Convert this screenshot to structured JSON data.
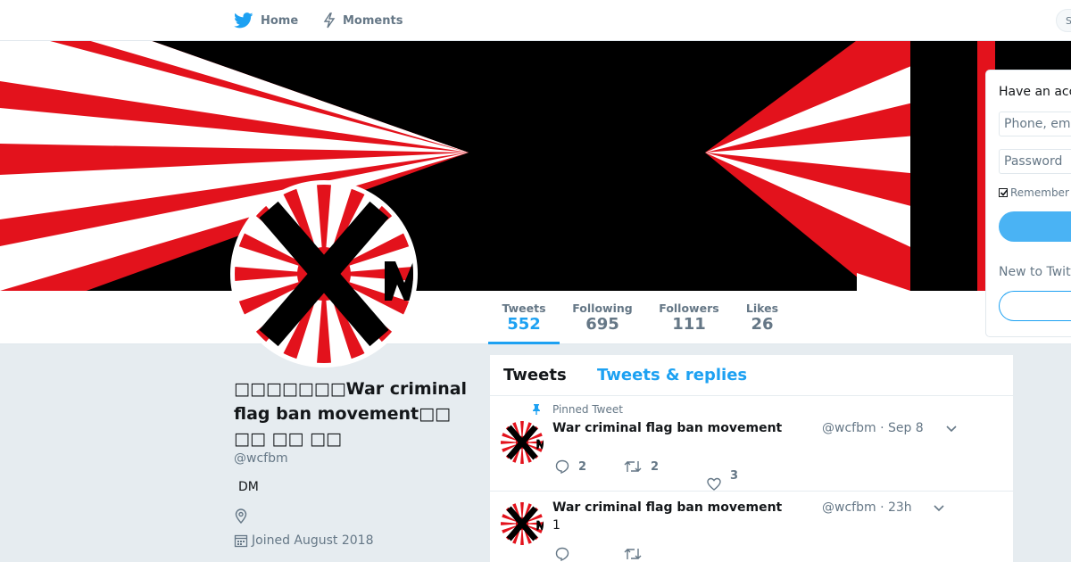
{
  "nav": {
    "home_label": "Home",
    "moments_label": "Moments",
    "search_stub": "S"
  },
  "profile": {
    "name": "□□□□□□□War criminal flag ban movement□□ □□ □□ □□",
    "handle": "@wcfbm",
    "bio": "DM",
    "joined": "Joined August 2018"
  },
  "stats": [
    {
      "label": "Tweets",
      "value": "552"
    },
    {
      "label": "Following",
      "value": "695"
    },
    {
      "label": "Followers",
      "value": "111"
    },
    {
      "label": "Likes",
      "value": "26"
    }
  ],
  "timeline": {
    "tabs": [
      "Tweets",
      "Tweets & replies"
    ],
    "tweets": [
      {
        "pinned_label": "Pinned Tweet",
        "fullname": "War criminal flag ban movement",
        "handle": "@wcfbm",
        "time": "· Sep 8",
        "text": "",
        "replies": "2",
        "retweets": "2",
        "likes": "3"
      },
      {
        "fullname": "War criminal flag ban movement",
        "handle": "@wcfbm",
        "time": "· 23h",
        "text": "1",
        "replies": "",
        "retweets": "",
        "likes": ""
      }
    ]
  },
  "login": {
    "title": "Have an account?",
    "phone_placeholder": "Phone, email or username",
    "password_placeholder": "Password",
    "remember": "Remember me",
    "new_text": "New to Twitter?"
  },
  "colors": {
    "brand_blue": "#1da1f2",
    "flag_red": "#e3121c",
    "background": "#e6ecf0"
  }
}
